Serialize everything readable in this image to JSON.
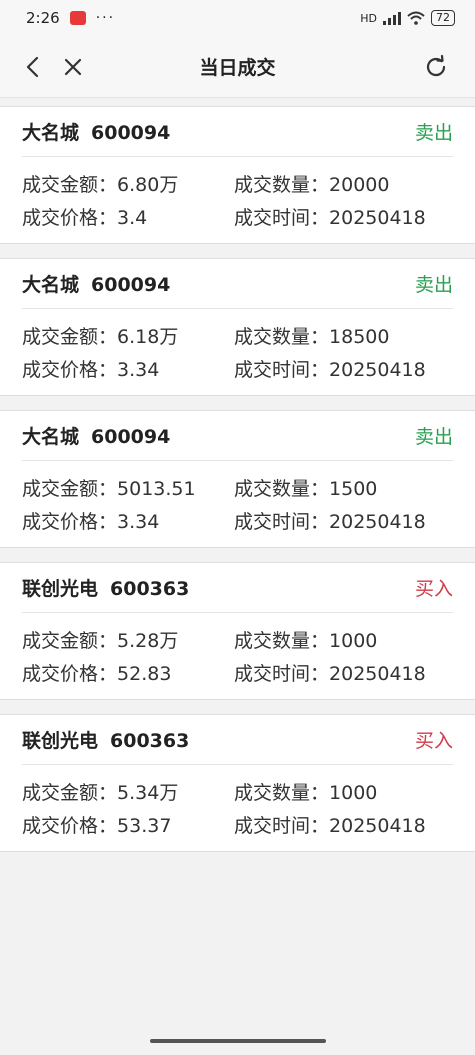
{
  "status": {
    "time": "2:26",
    "dots": "···",
    "network": "HD",
    "battery": "72"
  },
  "nav": {
    "title": "当日成交"
  },
  "trades": [
    {
      "name": "大名城",
      "code": "600094",
      "side": "卖出",
      "side_type": "sell",
      "amount_label": "成交金额：",
      "amount": "6.80万",
      "qty_label": "成交数量：",
      "qty": "20000",
      "price_label": "成交价格：",
      "price": "3.4",
      "time_label": "成交时间：",
      "time": "20250418"
    },
    {
      "name": "大名城",
      "code": "600094",
      "side": "卖出",
      "side_type": "sell",
      "amount_label": "成交金额：",
      "amount": "6.18万",
      "qty_label": "成交数量：",
      "qty": "18500",
      "price_label": "成交价格：",
      "price": "3.34",
      "time_label": "成交时间：",
      "time": "20250418"
    },
    {
      "name": "大名城",
      "code": "600094",
      "side": "卖出",
      "side_type": "sell",
      "amount_label": "成交金额：",
      "amount": "5013.51",
      "qty_label": "成交数量：",
      "qty": "1500",
      "price_label": "成交价格：",
      "price": "3.34",
      "time_label": "成交时间：",
      "time": "20250418"
    },
    {
      "name": "联创光电",
      "code": "600363",
      "side": "买入",
      "side_type": "buy",
      "amount_label": "成交金额：",
      "amount": "5.28万",
      "qty_label": "成交数量：",
      "qty": "1000",
      "price_label": "成交价格：",
      "price": "52.83",
      "time_label": "成交时间：",
      "time": "20250418"
    },
    {
      "name": "联创光电",
      "code": "600363",
      "side": "买入",
      "side_type": "buy",
      "amount_label": "成交金额：",
      "amount": "5.34万",
      "qty_label": "成交数量：",
      "qty": "1000",
      "price_label": "成交价格：",
      "price": "53.37",
      "time_label": "成交时间：",
      "time": "20250418"
    }
  ],
  "colors": {
    "sell": "#2aa050",
    "buy": "#d13a4a"
  }
}
